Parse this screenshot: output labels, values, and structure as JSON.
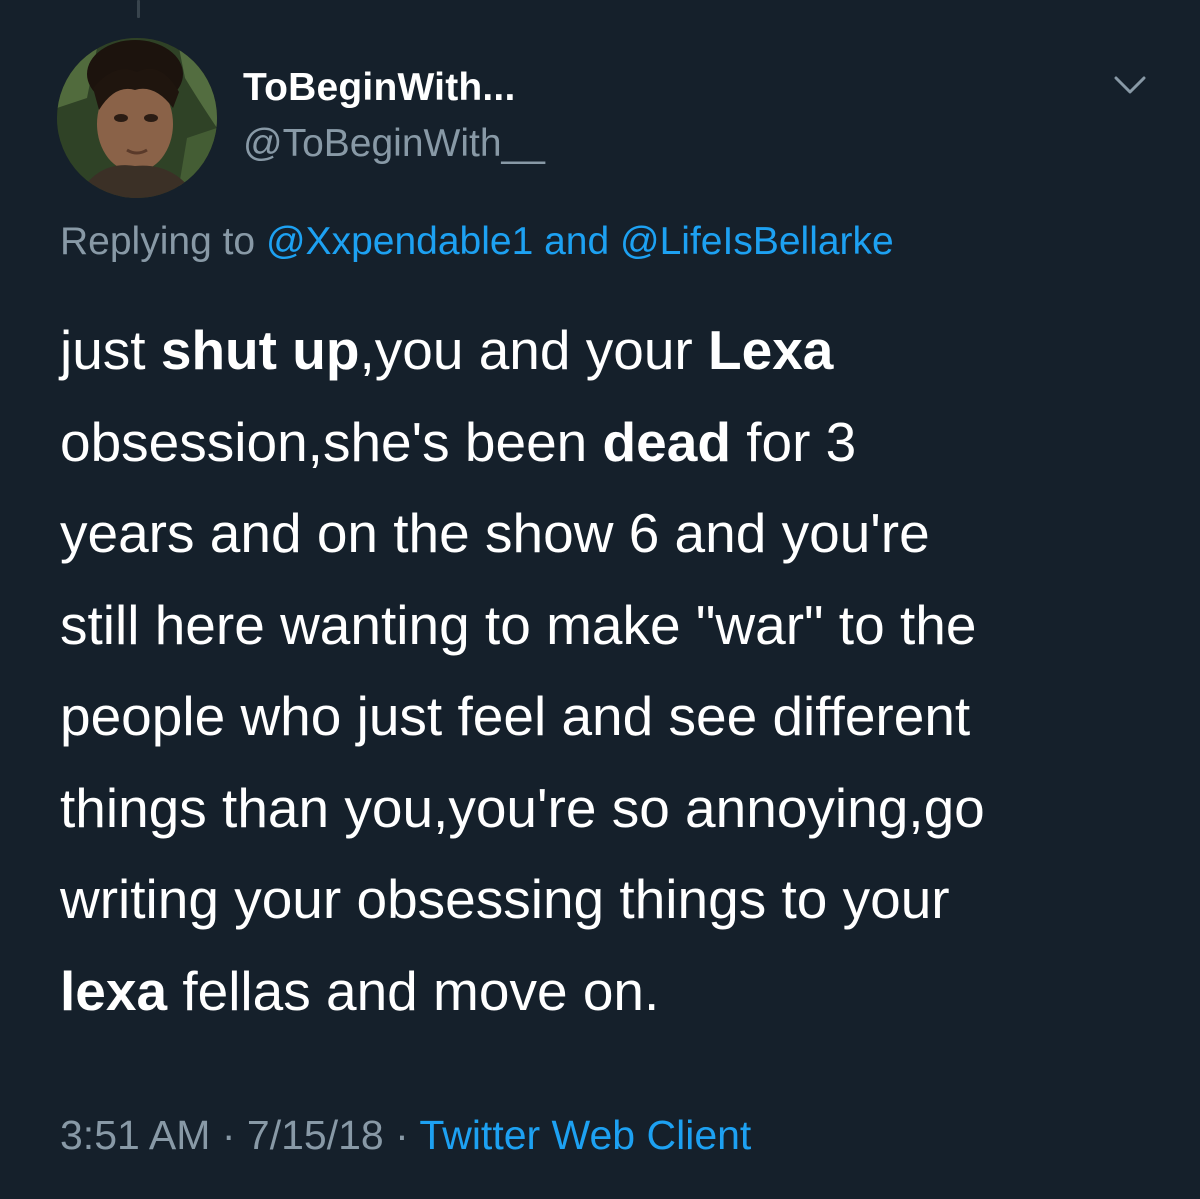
{
  "tweet": {
    "display_name": "ToBeginWith...",
    "handle": "@ToBeginWith__",
    "replying": {
      "prefix": "Replying to",
      "mention1": "@Xxpendable1",
      "joiner": "and",
      "mention2": "@LifeIsBellarke"
    },
    "lines": [
      [
        {
          "t": "just "
        },
        {
          "b": "shut up"
        },
        {
          "t": ",you and your "
        },
        {
          "b": "Lexa"
        }
      ],
      [
        {
          "t": "obsession,she's been "
        },
        {
          "b": "dead"
        },
        {
          "t": " for 3"
        }
      ],
      [
        {
          "t": "years and on the show 6 and you're"
        }
      ],
      [
        {
          "t": "still here wanting to make \"war\" to the"
        }
      ],
      [
        {
          "t": "people who just feel and see different"
        }
      ],
      [
        {
          "t": "things than you,you're so annoying,go"
        }
      ],
      [
        {
          "t": "writing your obsessing things to your"
        }
      ],
      [
        {
          "b": "lexa"
        },
        {
          "t": " fellas and move on."
        }
      ]
    ],
    "time": "3:51 AM",
    "separator": "·",
    "date": "7/15/18",
    "source": "Twitter Web Client"
  },
  "colors": {
    "background": "#15202b",
    "primary_text": "#ffffff",
    "secondary_text": "#8899a6",
    "accent": "#1da1f2"
  },
  "icons": {
    "menu": "chevron-down-icon"
  }
}
